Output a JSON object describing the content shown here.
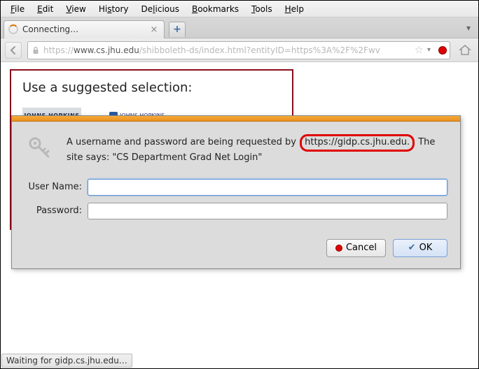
{
  "menu": {
    "items": [
      {
        "label": "File",
        "accel": "F"
      },
      {
        "label": "Edit",
        "accel": "E"
      },
      {
        "label": "View",
        "accel": "V"
      },
      {
        "label": "History",
        "accel": "H"
      },
      {
        "label": "Delicious",
        "accel": "l"
      },
      {
        "label": "Bookmarks",
        "accel": "B"
      },
      {
        "label": "Tools",
        "accel": "T"
      },
      {
        "label": "Help",
        "accel": "H"
      }
    ]
  },
  "tab": {
    "title": "Connecting…",
    "close_glyph": "×",
    "newtab_glyph": "+",
    "overflow_glyph": "▾"
  },
  "nav": {
    "back_glyph": "⟨",
    "url_scheme": "https://",
    "url_host": "www.cs.jhu.edu",
    "url_path": "/shibboleth-ds/index.html?entityID=https%3A%2F%2Fwv",
    "star_glyph": "☆",
    "dropdown_glyph": "▾"
  },
  "page": {
    "suggest_title": "Use a suggested selection:",
    "logo1_text": "JOHNS HOPKINS",
    "logo2_text": "JOHNS HOPKINS"
  },
  "dialog": {
    "msg_pre": "A username and password are being requested by ",
    "msg_host": "https://gidp.cs.jhu.edu.",
    "msg_post": " The site says: \"CS Department Grad Net Login\"",
    "label_user": "User Name:",
    "label_pass": "Password:",
    "value_user": "",
    "value_pass": "",
    "btn_cancel": "Cancel",
    "btn_ok": "OK",
    "check_glyph": "✔"
  },
  "status": {
    "text": "Waiting for gidp.cs.jhu.edu…"
  }
}
